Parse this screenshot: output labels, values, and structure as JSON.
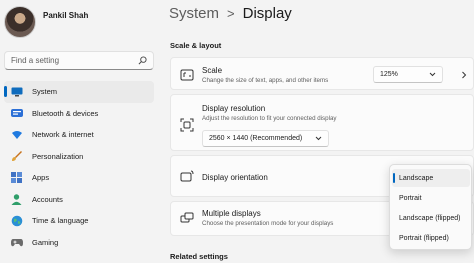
{
  "profile": {
    "name": "Pankil Shah"
  },
  "search": {
    "placeholder": "Find a setting"
  },
  "sidebar": {
    "items": [
      {
        "label": "System",
        "icon": "monitor-icon",
        "active": true
      },
      {
        "label": "Bluetooth & devices",
        "icon": "bluetooth-icon"
      },
      {
        "label": "Network & internet",
        "icon": "wifi-icon"
      },
      {
        "label": "Personalization",
        "icon": "brush-icon"
      },
      {
        "label": "Apps",
        "icon": "apps-icon"
      },
      {
        "label": "Accounts",
        "icon": "person-icon"
      },
      {
        "label": "Time & language",
        "icon": "globe-icon"
      },
      {
        "label": "Gaming",
        "icon": "gamepad-icon"
      }
    ]
  },
  "header": {
    "parent": "System",
    "separator": ">",
    "current": "Display"
  },
  "sections": {
    "scale_layout": "Scale & layout",
    "related": "Related settings"
  },
  "scale": {
    "title": "Scale",
    "description": "Change the size of text, apps, and other items",
    "value": "125%"
  },
  "resolution": {
    "title": "Display resolution",
    "description": "Adjust the resolution to fit your connected display",
    "value": "2560 × 1440 (Recommended)"
  },
  "orientation": {
    "title": "Display orientation",
    "options": [
      "Landscape",
      "Portrait",
      "Landscape (flipped)",
      "Portrait (flipped)"
    ],
    "selected": "Landscape"
  },
  "multiple": {
    "title": "Multiple displays",
    "description": "Choose the presentation mode for your displays"
  },
  "colors": {
    "accent": "#0067c0",
    "background": "#f3f3f3",
    "card": "#fbfbfb"
  }
}
